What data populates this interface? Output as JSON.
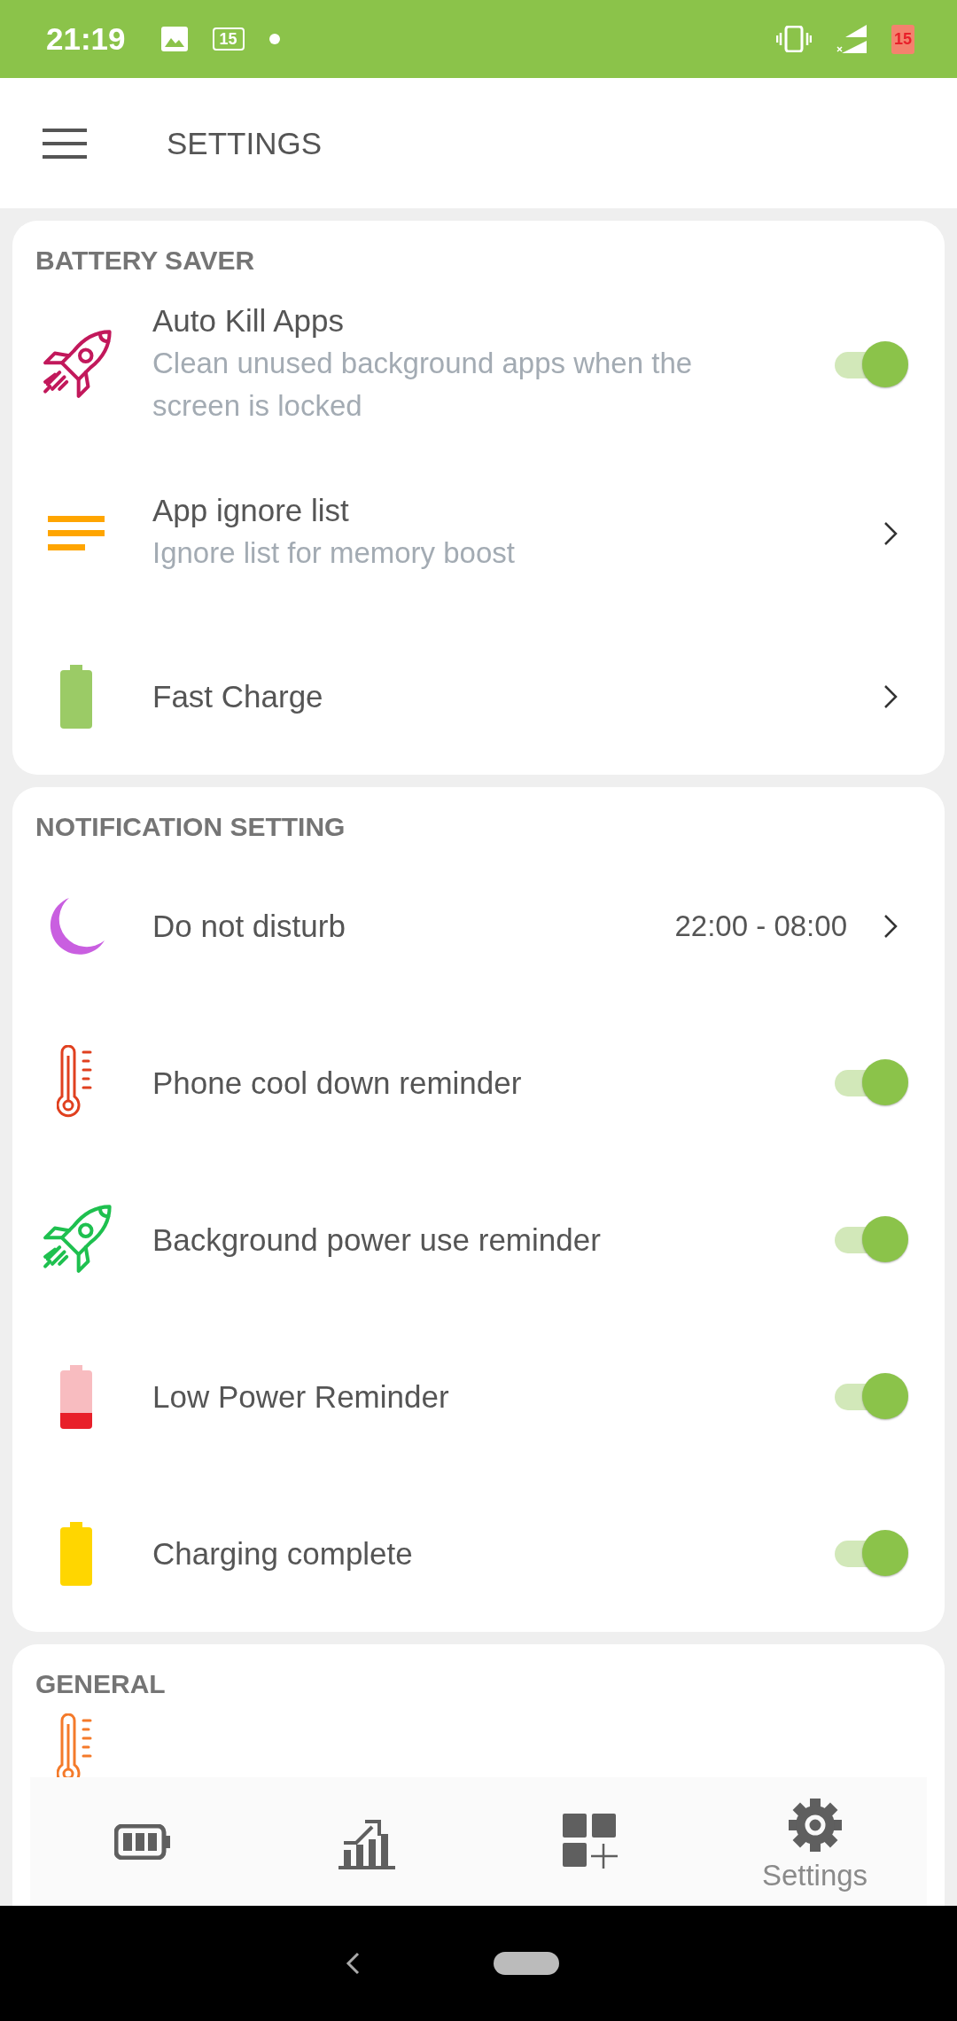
{
  "status_bar": {
    "time": "21:19",
    "battery_badge": "15",
    "battery_level_text": "15"
  },
  "header": {
    "title": "SETTINGS"
  },
  "sections": [
    {
      "title": "BATTERY SAVER",
      "rows": [
        {
          "kind": "toggle",
          "title": "Auto Kill Apps",
          "subtitle": "Clean unused background apps when the screen is locked",
          "on": true
        },
        {
          "kind": "link",
          "title": "App ignore list",
          "subtitle": "Ignore list for memory boost"
        },
        {
          "kind": "link",
          "title": "Fast Charge"
        }
      ]
    },
    {
      "title": "NOTIFICATION SETTING",
      "rows": [
        {
          "kind": "link",
          "title": "Do not disturb",
          "value": "22:00 - 08:00"
        },
        {
          "kind": "toggle",
          "title": "Phone cool down reminder",
          "on": true
        },
        {
          "kind": "toggle",
          "title": "Background power use reminder",
          "on": true
        },
        {
          "kind": "toggle",
          "title": "Low Power Reminder",
          "on": true
        },
        {
          "kind": "toggle",
          "title": "Charging complete",
          "on": true
        }
      ]
    },
    {
      "title": "GENERAL"
    }
  ],
  "bottom_nav": [
    {
      "selected": false
    },
    {
      "selected": false
    },
    {
      "selected": false
    },
    {
      "selected": true,
      "label": "Settings"
    }
  ]
}
